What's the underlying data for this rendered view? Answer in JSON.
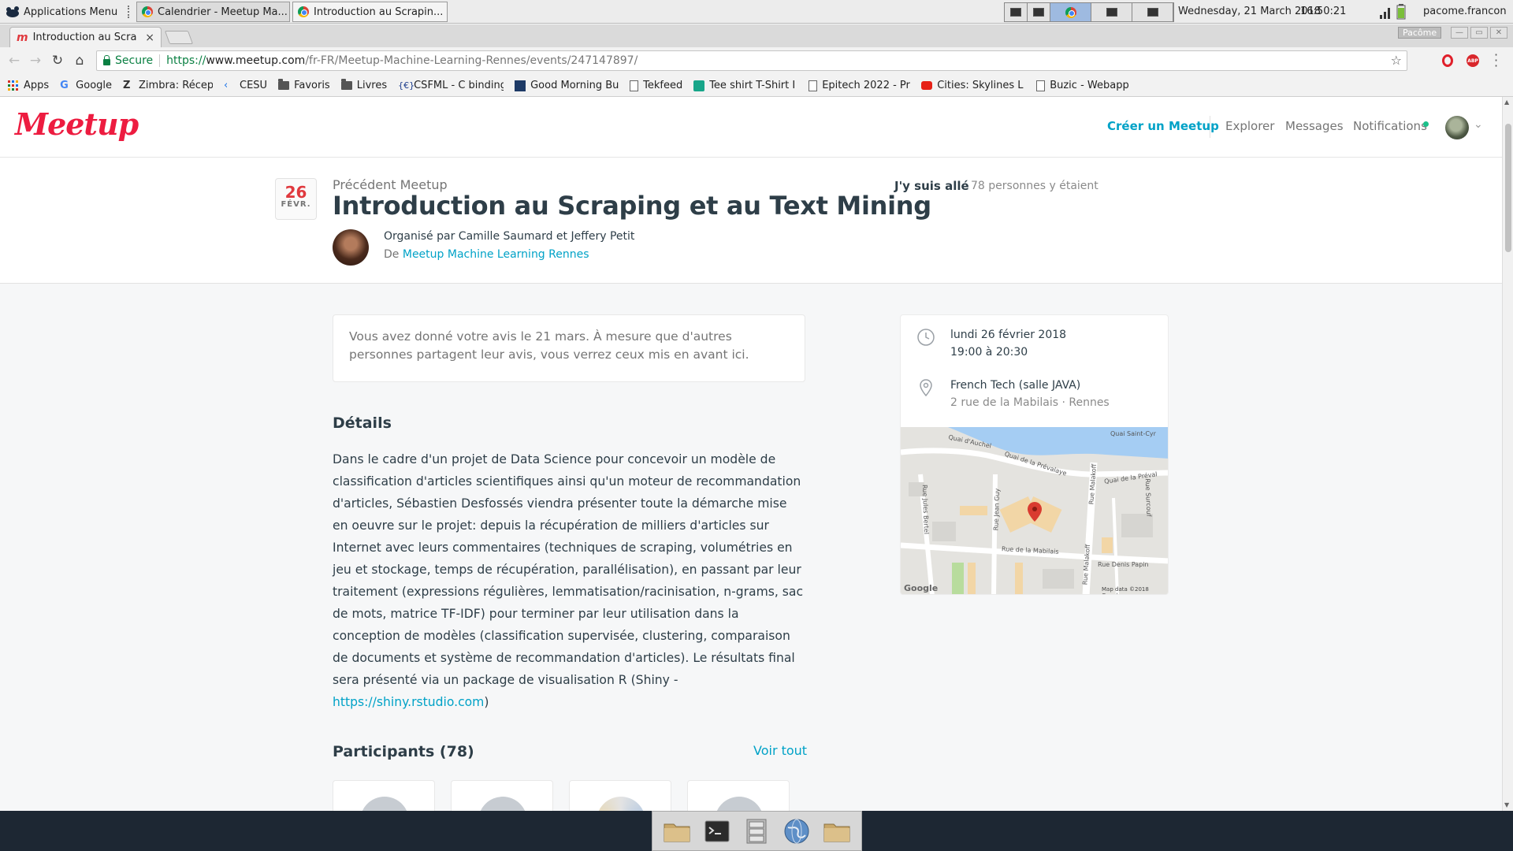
{
  "panel": {
    "app_menu": "Applications Menu",
    "tasks": [
      {
        "label": "Calendrier - Meetup Ma..."
      },
      {
        "label": "Introduction au Scrapin..."
      }
    ],
    "date": "Wednesday, 21 March 2018",
    "time": "16:50:21",
    "user": "pacome.francon"
  },
  "browser": {
    "active_tab": "Introduction au Scra",
    "tab_close": "×",
    "profile": "Pacôme",
    "secure_label": "Secure",
    "url_scheme": "https://",
    "url_host": "www.meetup.com",
    "url_path": "/fr-FR/Meetup-Machine-Learning-Rennes/events/247147897/",
    "bookmarks": [
      {
        "label": "Apps",
        "icon": "apps-grid-icon"
      },
      {
        "label": "Google",
        "icon": "google-icon"
      },
      {
        "label": "Zimbra: Réceptio",
        "icon": "zimbra-icon"
      },
      {
        "label": "CESU",
        "icon": "cesu-icon"
      },
      {
        "label": "Favoris",
        "icon": "folder-icon"
      },
      {
        "label": "Livres",
        "icon": "folder-icon"
      },
      {
        "label": "CSFML - C binding",
        "icon": "csfml-icon"
      },
      {
        "label": "Good Morning Bu",
        "icon": "page-icon"
      },
      {
        "label": "Tekfeed",
        "icon": "page-icon"
      },
      {
        "label": "Tee shirt T-Shirt I",
        "icon": "teeshirt-icon"
      },
      {
        "label": "Epitech 2022 - Pr",
        "icon": "page-icon"
      },
      {
        "label": "Cities: Skylines L",
        "icon": "youtube-icon"
      },
      {
        "label": "Buzic - Webapp",
        "icon": "page-icon"
      }
    ]
  },
  "site": {
    "logo": "Meetup",
    "nav": {
      "create": "Créer un Meetup",
      "explore": "Explorer",
      "messages": "Messages",
      "notifications": "Notifications"
    }
  },
  "event": {
    "date_day": "26",
    "date_month": "FÉVR.",
    "previous_label": "Précédent Meetup",
    "title": "Introduction au Scraping et au Text Mining",
    "organized_by": "Organisé par Camille Saumard et Jeffery Petit",
    "group_prefix": "De",
    "group_name": "Meetup Machine Learning Rennes",
    "attended_label": "J'y suis allé",
    "attended_count": "78 personnes y étaient",
    "review_notice": "Vous avez donné votre avis le 21 mars. À mesure que d'autres personnes partagent leur avis, vous verrez ceux mis en avant ici.",
    "details_heading": "Détails",
    "details_text": "Dans le cadre d'un projet de Data Science pour concevoir un modèle de classification d'articles scientifiques ainsi qu'un moteur de recommandation d'articles, Sébastien Desfossés viendra présenter toute la démarche mise en oeuvre sur le projet: depuis la récupération de milliers d'articles sur Internet avec leurs commentaires (techniques de scraping, volumétries en jeu et stockage, temps de récupération, parallélisation), en passant par leur traitement (expressions régulières, lemmatisation/racinisation, n-grams, sac de mots, matrice TF-IDF) pour terminer par leur utilisation dans la conception de modèles (classification supervisée, clustering, comparaison de documents et système de recommandation d'articles). Le résultats final sera présenté via un package de visualisation R (Shiny - ",
    "details_link": "https://shiny.rstudio.com",
    "details_end": ")",
    "participants_heading": "Participants (78)",
    "see_all": "Voir tout",
    "when_date": "lundi 26 février 2018",
    "when_time": "19:00 à 20:30",
    "venue_name": "French Tech (salle JAVA)",
    "venue_address": "2 rue de la Mabilais · Rennes",
    "map": {
      "streets": [
        "Quai d'Auchel",
        "Quai de la Prévalaye",
        "Quai Saint-Cyr",
        "Quai de la Préval",
        "Rue Malakoff",
        "Rue Jean Guy",
        "Rue Jules Bertel",
        "Rue de la Mabilais",
        "Rue Malakoff",
        "Rue Denis Papin",
        "Rue Surcouf"
      ],
      "google_label": "Google",
      "attribution": "Map data ©2018 Google"
    }
  },
  "colors": {
    "brand": "#ed1c40",
    "link": "#00a2c7",
    "text": "#2e3e48"
  }
}
